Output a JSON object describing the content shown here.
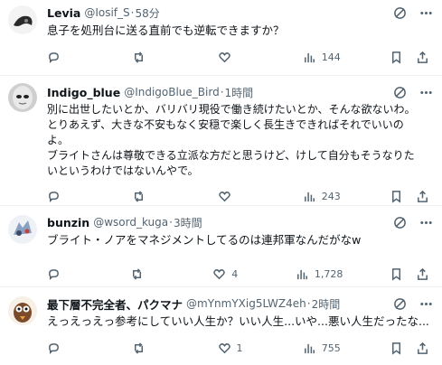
{
  "tweets": [
    {
      "name": "Levia",
      "handle": "@Iosif_S",
      "time": "58分",
      "text": "息子を処刑台に送る直前でも逆転できますか？",
      "replies": "",
      "reposts": "",
      "likes": "",
      "views": "144"
    },
    {
      "name": "Indigo_blue",
      "handle": "@IndigoBlue_Bird",
      "time": "1時間",
      "text": "別に出世したいとか、バリバリ現役で働き続けたいとか、そんな欲ないわ。\nとりあえず、大きな不安もなく安穏で楽しく長生きできればそれでいいの\nよ。\nブライトさんは尊敬できる立派な方だと思うけど、けして自分もそうなりた\nいというわけではないんやで。",
      "replies": "",
      "reposts": "",
      "likes": "",
      "views": "243"
    },
    {
      "name": "bunzin",
      "handle": "@wsord_kuga",
      "time": "3時間",
      "text": "ブライト・ノアをマネジメントしてるのは連邦軍なんだがなw",
      "replies": "",
      "reposts": "",
      "likes": "4",
      "views": "1,728"
    },
    {
      "name": "最下層不完全者、パクマナ",
      "handle": "@mYnmYXig5LWZ4eh",
      "time": "2時間",
      "text": "えっえっえっ参考にしていい人生か？いい人生...いや...悪い人生だったな...",
      "replies": "",
      "reposts": "",
      "likes": "1",
      "views": "755"
    }
  ],
  "icons": {
    "reply": "reply-icon",
    "repost": "repost-icon",
    "like": "heart-icon",
    "views": "views-icon",
    "bookmark": "bookmark-icon",
    "share": "share-icon",
    "grok": "grok-icon",
    "more": "more-icon"
  }
}
